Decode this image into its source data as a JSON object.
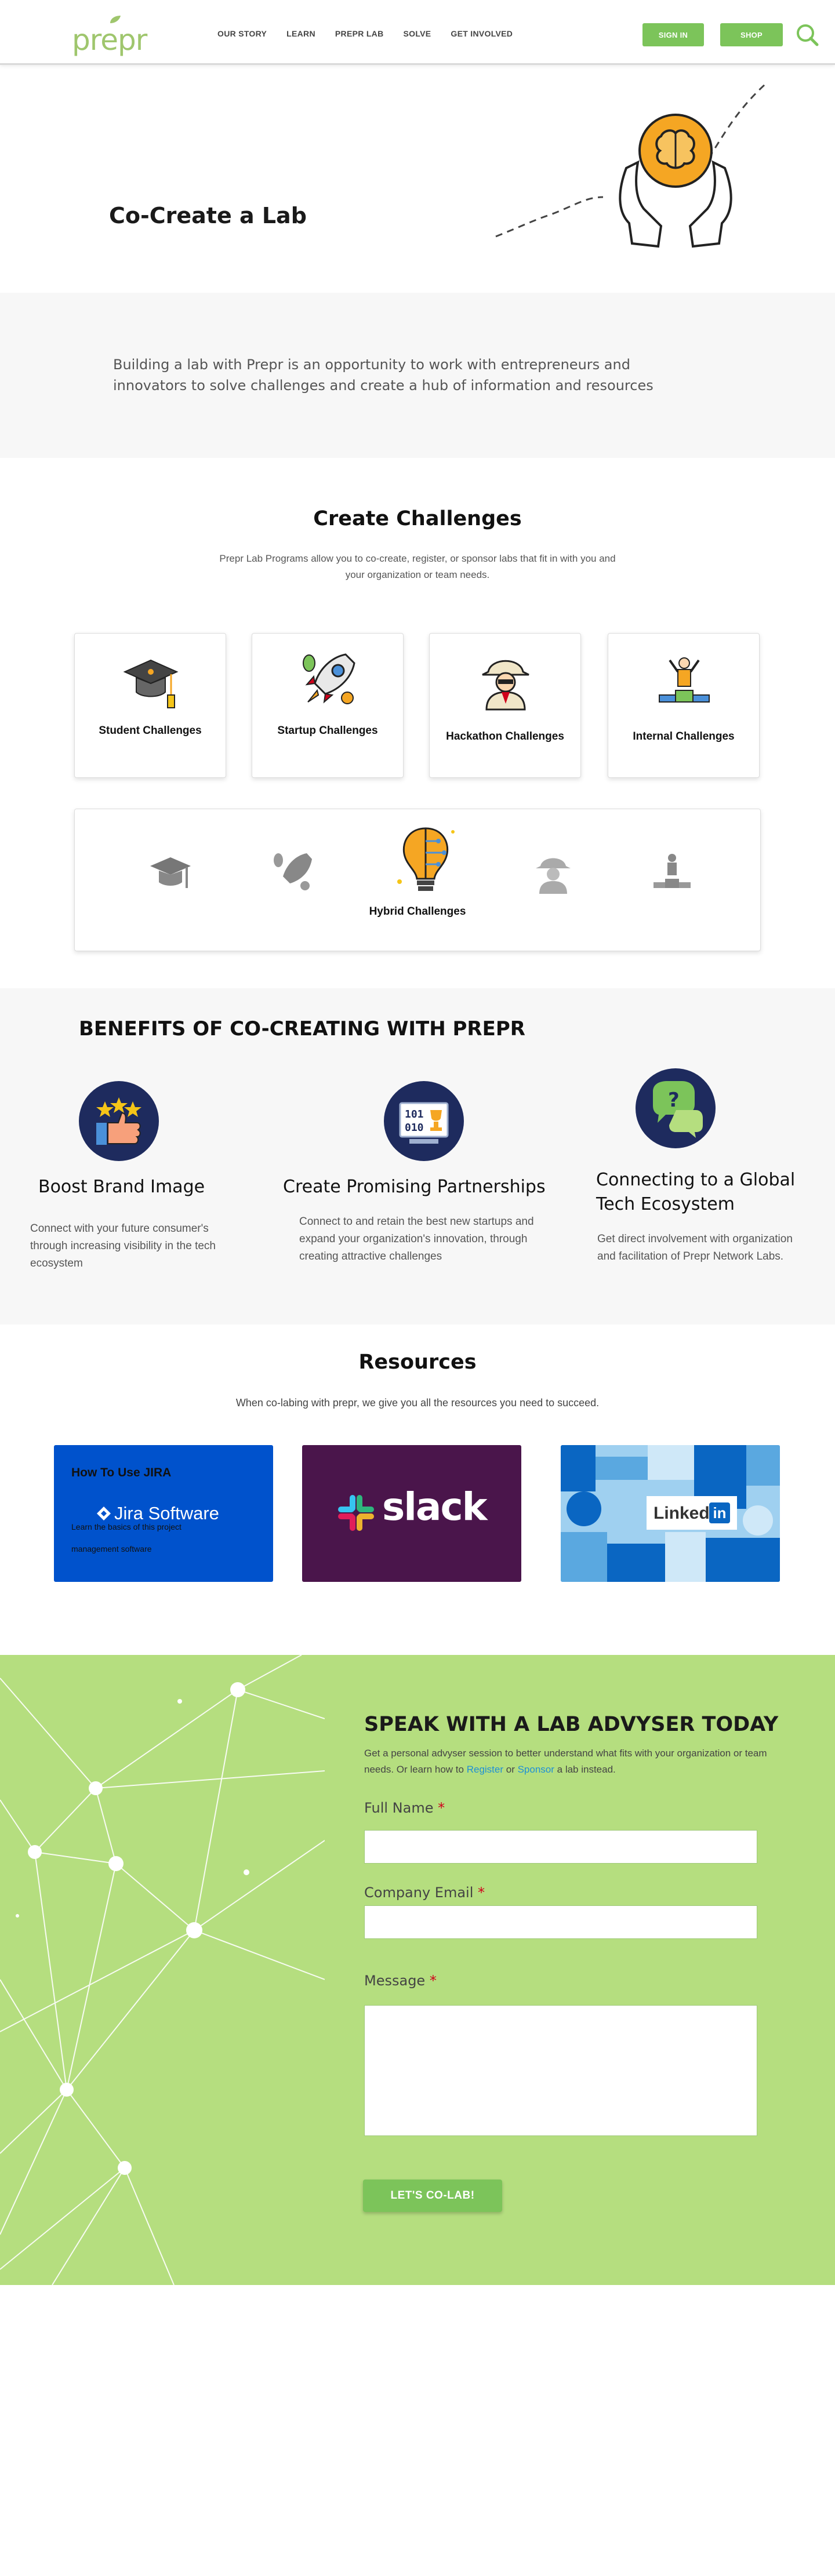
{
  "header": {
    "logo_text": "prepr",
    "nav": [
      "OUR STORY",
      "LEARN",
      "PREPR LAB",
      "SOLVE",
      "GET INVOLVED"
    ],
    "signin_label": "SIGN IN",
    "shop_label": "SHOP",
    "search_icon": "search-icon"
  },
  "hero": {
    "title": "Co-Create a Lab"
  },
  "intro": {
    "text": "Building a lab with Prepr is an opportunity to work with entrepreneurs and innovators to solve challenges and create a hub of information and resources"
  },
  "challenges": {
    "title": "Create Challenges",
    "subtitle": "Prepr Lab Programs allow you to co-create, register, or sponsor labs that fit in with you and your organization or team needs.",
    "cards": [
      {
        "label": "Student Challenges",
        "icon": "graduation-cap-icon"
      },
      {
        "label": "Startup Challenges",
        "icon": "rocket-icon"
      },
      {
        "label": "Hackathon Challenges",
        "icon": "detective-icon"
      },
      {
        "label": "Internal Challenges",
        "icon": "podium-icon"
      }
    ],
    "hybrid_label": "Hybrid Challenges"
  },
  "benefits": {
    "title": "BENEFITS OF CO-CREATING WITH PREPR",
    "items": [
      {
        "title": "Boost Brand Image",
        "text": "Connect with your future consumer's through increasing visibility in the tech ecosystem",
        "icon": "thumbs-up-stars-icon"
      },
      {
        "title": "Create Promising Partnerships",
        "text": "Connect to and retain the best new startups and expand your organization's innovation, through creating attractive challenges",
        "icon": "binary-trophy-icon"
      },
      {
        "title": "Connecting to a Global Tech Ecosystem",
        "text": "Get direct involvement with organization and facilitation of Prepr Network Labs.",
        "icon": "chat-question-icon"
      }
    ]
  },
  "resources": {
    "title": "Resources",
    "subtitle": "When co-labing with prepr, we give you all the resources you need to succeed.",
    "jira": {
      "heading": "How To Use JIRA",
      "brand": "Jira Software",
      "overlay": "Learn the basics of this project management software"
    },
    "slack": {
      "brand": "slack"
    },
    "linkedin": {
      "brand": "Linked",
      "brand_in": "in"
    }
  },
  "contact": {
    "title": "SPEAK WITH A LAB ADVYSER TODAY",
    "sub_prefix": "Get a personal advyser session to better understand what fits with your organization or team needs. Or learn how to ",
    "register_link": "Register",
    "or_text": " or ",
    "sponsor_link": "Sponsor",
    "sub_suffix": " a lab instead.",
    "name_label": "Full Name",
    "email_label": "Company Email",
    "message_label": "Message",
    "required_mark": "*",
    "submit_label": "LET'S CO-LAB!"
  },
  "colors": {
    "brand_green": "#7cc45a",
    "contact_bg": "#b5de7f",
    "navy": "#1e2b5e",
    "jira_blue": "#0052cc",
    "slack_purple": "#4a154b",
    "linkedin_blue": "#0a66c2"
  }
}
